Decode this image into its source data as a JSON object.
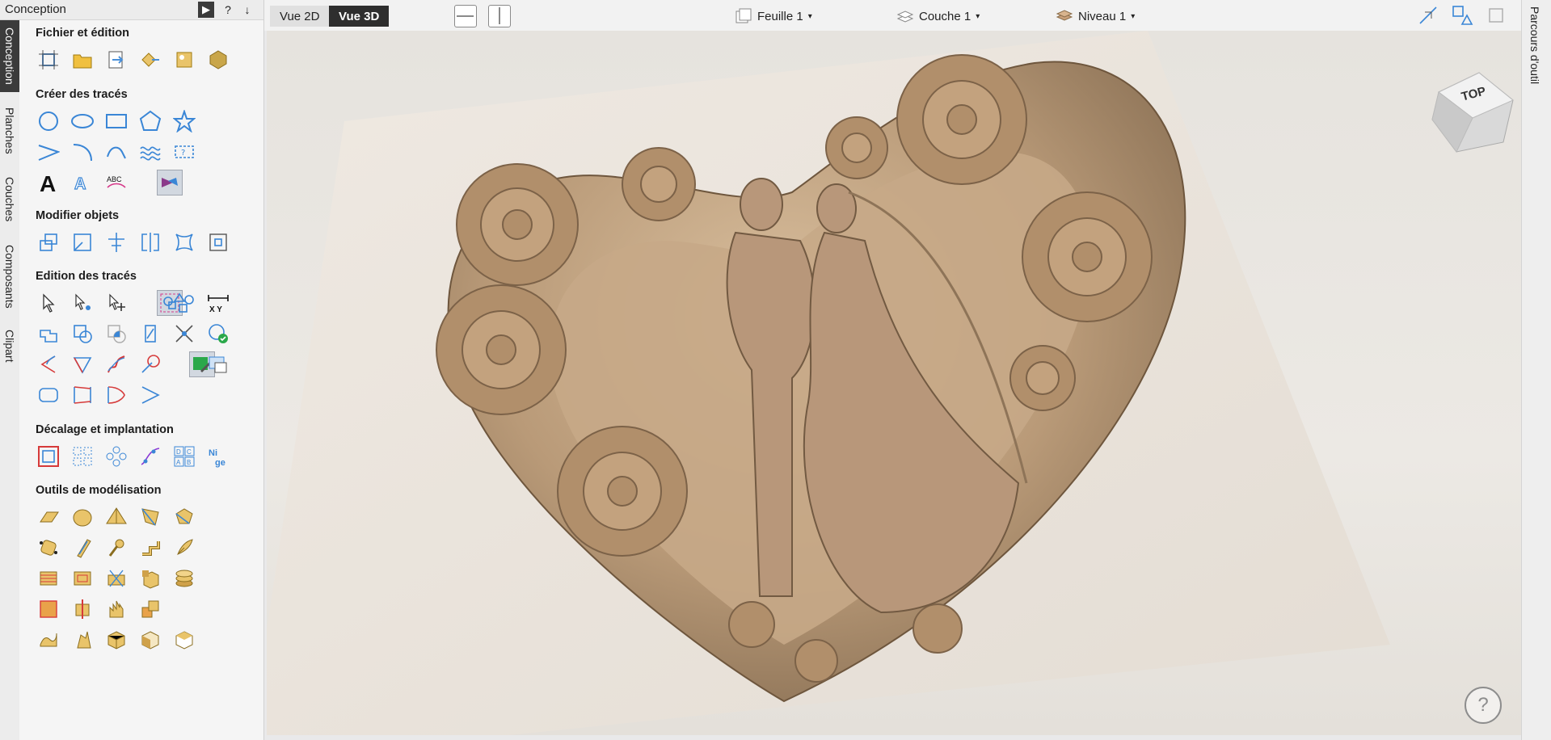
{
  "panel": {
    "title": "Conception",
    "sections": {
      "file": "Fichier et édition",
      "create": "Créer des tracés",
      "modify": "Modifier objets",
      "edit": "Edition des tracés",
      "offset": "Décalage et implantation",
      "model": "Outils de modélisation"
    }
  },
  "vtabs": [
    "Conception",
    "Planches",
    "Couches",
    "Composants",
    "Clipart"
  ],
  "top": {
    "view2d": "Vue 2D",
    "view3d": "Vue 3D",
    "sheet": "Feuille 1",
    "layer": "Couche 1",
    "level": "Niveau 1"
  },
  "right_tab": "Parcours d'outil",
  "cube_label": "TOP",
  "help": "?",
  "panel_help": "?",
  "accent": "#4a90d9",
  "tool_yellow": "#e9c46a"
}
